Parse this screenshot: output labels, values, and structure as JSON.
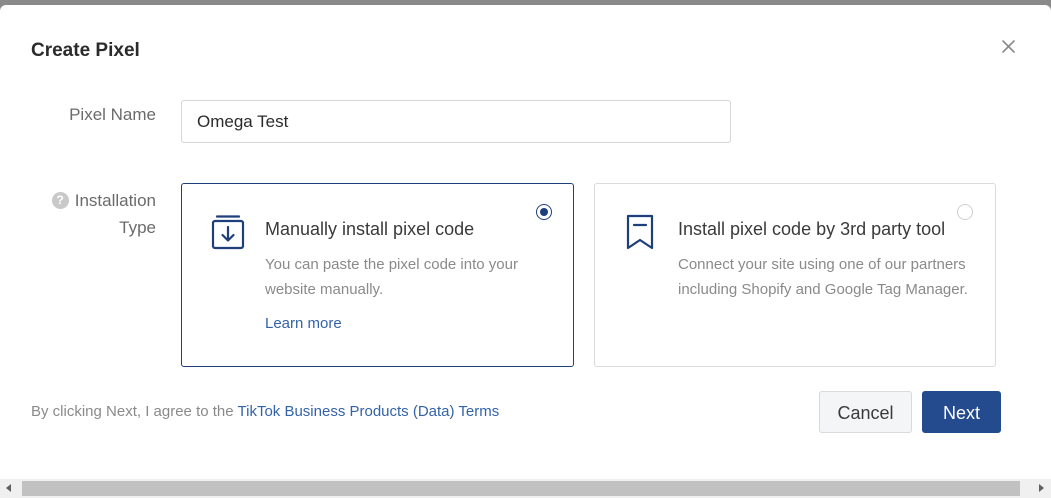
{
  "dialog": {
    "title": "Create Pixel"
  },
  "form": {
    "pixel_name_label": "Pixel Name",
    "pixel_name_value": "Omega Test",
    "installation_type_label": "Installation Type"
  },
  "options": [
    {
      "title": "Manually install pixel code",
      "description": "You can paste the pixel code into your website manually.",
      "link": "Learn more",
      "selected": true,
      "icon": "download-box-icon"
    },
    {
      "title": "Install pixel code by 3rd party tool",
      "description": "Connect your site using one of our partners including Shopify and Google Tag Manager.",
      "selected": false,
      "icon": "bookmark-icon"
    }
  ],
  "footer": {
    "terms_prefix": "By clicking Next, I agree to the ",
    "terms_link": "TikTok Business Products (Data) Terms",
    "cancel_label": "Cancel",
    "next_label": "Next"
  },
  "colors": {
    "primary": "#234b8e",
    "link": "#3463a8",
    "selected_border": "#1f3f7a"
  }
}
